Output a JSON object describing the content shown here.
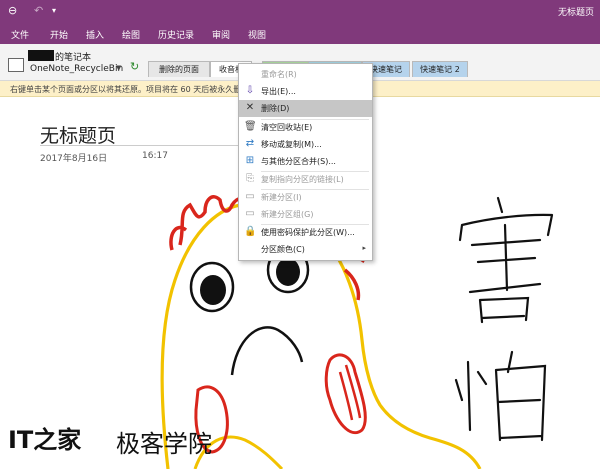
{
  "window": {
    "title": "无标题页"
  },
  "quick_access": {
    "back_icon": "back-icon",
    "undo_icon": "undo-icon"
  },
  "ribbon": {
    "tabs": [
      "文件",
      "开始",
      "插入",
      "绘图",
      "历史记录",
      "审阅",
      "视图"
    ]
  },
  "notebook": {
    "name": "的笔记本",
    "recycle_bin": "OneNote_RecycleBin",
    "dropdown": "▼",
    "sync": "↻"
  },
  "section_tabs": [
    "删除的页面",
    "收音机",
    "快速笔记",
    "快速笔记 2"
  ],
  "info_bar": {
    "text": "右键单击某个页面或分区以将其还原。项目将在 60 天后被永久删除"
  },
  "page": {
    "title": "无标题页",
    "date": "2017年8月16日",
    "time": "16:17"
  },
  "context_menu": {
    "items": [
      {
        "label": "重命名(R)",
        "icon": "rename-icon",
        "disabled": true,
        "glyph": ""
      },
      {
        "label": "导出(E)...",
        "icon": "export-icon",
        "disabled": false,
        "glyph": "⇩"
      },
      {
        "label": "删除(D)",
        "icon": "delete-icon",
        "disabled": false,
        "glyph": "✕",
        "highlighted": true
      },
      {
        "label": "清空回收站(E)",
        "icon": "trash-icon",
        "disabled": false,
        "glyph": "🗑"
      },
      {
        "label": "移动或复制(M)...",
        "icon": "move-icon",
        "disabled": false,
        "glyph": "⇄"
      },
      {
        "label": "与其他分区合并(S)...",
        "icon": "merge-icon",
        "disabled": false,
        "glyph": "⊞"
      },
      {
        "label": "复制指向分区的链接(L)",
        "icon": "link-icon",
        "disabled": true,
        "glyph": "⎘"
      },
      {
        "label": "新建分区(I)",
        "icon": "new-section-icon",
        "disabled": true,
        "glyph": "▭"
      },
      {
        "label": "新建分区组(G)",
        "icon": "new-section-group-icon",
        "disabled": true,
        "glyph": "▭"
      },
      {
        "label": "使用密码保护此分区(W)...",
        "icon": "lock-icon",
        "disabled": false,
        "glyph": "🔒"
      },
      {
        "label": "分区颜色(C)",
        "icon": "color-icon",
        "disabled": false,
        "glyph": "",
        "submenu": "▸"
      }
    ]
  },
  "handwriting": {
    "text": "害怕"
  },
  "watermark": {
    "logo": "IT之家",
    "text": "极客学院"
  },
  "colors": {
    "ribbon": "#80397b",
    "info_bar": "#fdf0c8",
    "menu_highlight": "#c6c6c6"
  }
}
